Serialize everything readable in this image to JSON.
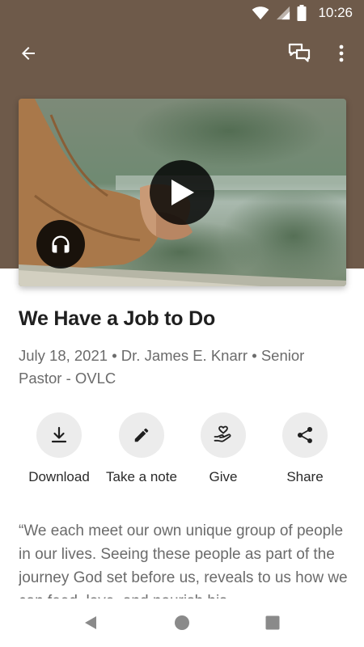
{
  "status_bar": {
    "time": "10:26"
  },
  "app_bar": {
    "back_icon": "arrow-back-icon",
    "chat_icon": "chat-bubbles-icon",
    "more_icon": "more-vert-icon"
  },
  "media": {
    "play_icon": "play-icon",
    "audio_icon": "headphones-icon"
  },
  "sermon": {
    "title": "We Have a Job to Do",
    "meta": "July 18, 2021 • Dr. James E. Knarr • Senior Pastor - OVLC",
    "description": "“We each meet our own unique group of people in our lives. Seeing these people as part of the journey God set before us, reveals to us how we can feed, love, and nourish his"
  },
  "actions": [
    {
      "label": "Download",
      "icon": "download-icon"
    },
    {
      "label": "Take a note",
      "icon": "pencil-icon"
    },
    {
      "label": "Give",
      "icon": "give-heart-hand-icon"
    },
    {
      "label": "Share",
      "icon": "share-icon"
    }
  ],
  "colors": {
    "header_brown": "#6e5a4a",
    "action_circle": "#ececec",
    "secondary_text": "#6b6b6b"
  }
}
